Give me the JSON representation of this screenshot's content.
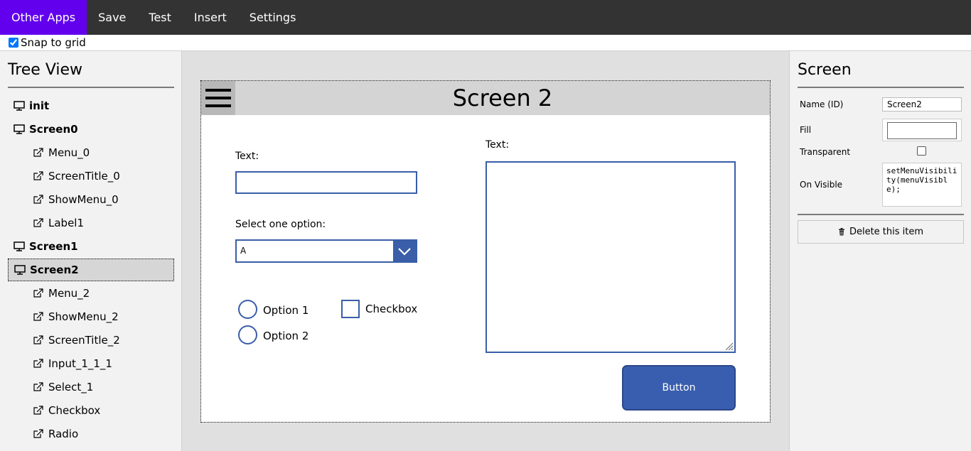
{
  "menubar": {
    "items": [
      "Other Apps",
      "Save",
      "Test",
      "Insert",
      "Settings"
    ]
  },
  "snap": {
    "label": "Snap to grid",
    "checked": true
  },
  "tree": {
    "title": "Tree View",
    "items": [
      {
        "label": "init",
        "type": "screen"
      },
      {
        "label": "Screen0",
        "type": "screen"
      },
      {
        "label": "Menu_0",
        "type": "child"
      },
      {
        "label": "ScreenTitle_0",
        "type": "child"
      },
      {
        "label": "ShowMenu_0",
        "type": "child"
      },
      {
        "label": "Label1",
        "type": "child"
      },
      {
        "label": "Screen1",
        "type": "screen"
      },
      {
        "label": "Screen2",
        "type": "screen",
        "selected": true
      },
      {
        "label": "Menu_2",
        "type": "child"
      },
      {
        "label": "ShowMenu_2",
        "type": "child"
      },
      {
        "label": "ScreenTitle_2",
        "type": "child"
      },
      {
        "label": "Input_1_1_1",
        "type": "child"
      },
      {
        "label": "Select_1",
        "type": "child"
      },
      {
        "label": "Checkbox",
        "type": "child"
      },
      {
        "label": "Radio",
        "type": "child"
      }
    ]
  },
  "canvas": {
    "screen_title": "Screen 2",
    "text_label": "Text:",
    "select_label": "Select one option:",
    "select_value": "A",
    "radio1": "Option 1",
    "radio2": "Option 2",
    "checkbox_label": "Checkbox",
    "textarea_label": "Text:",
    "button_label": "Button"
  },
  "props": {
    "title": "Screen",
    "name_label": "Name (ID)",
    "name_value": "Screen2",
    "fill_label": "Fill",
    "transparent_label": "Transparent",
    "onvisible_label": "On Visible",
    "onvisible_code": "setMenuVisibility(menuVisible);",
    "delete_label": "Delete this item"
  },
  "colors": {
    "menubar_bg": "#333333",
    "active_menu": "#6200ee",
    "accent_blue": "#3a5ea8"
  }
}
